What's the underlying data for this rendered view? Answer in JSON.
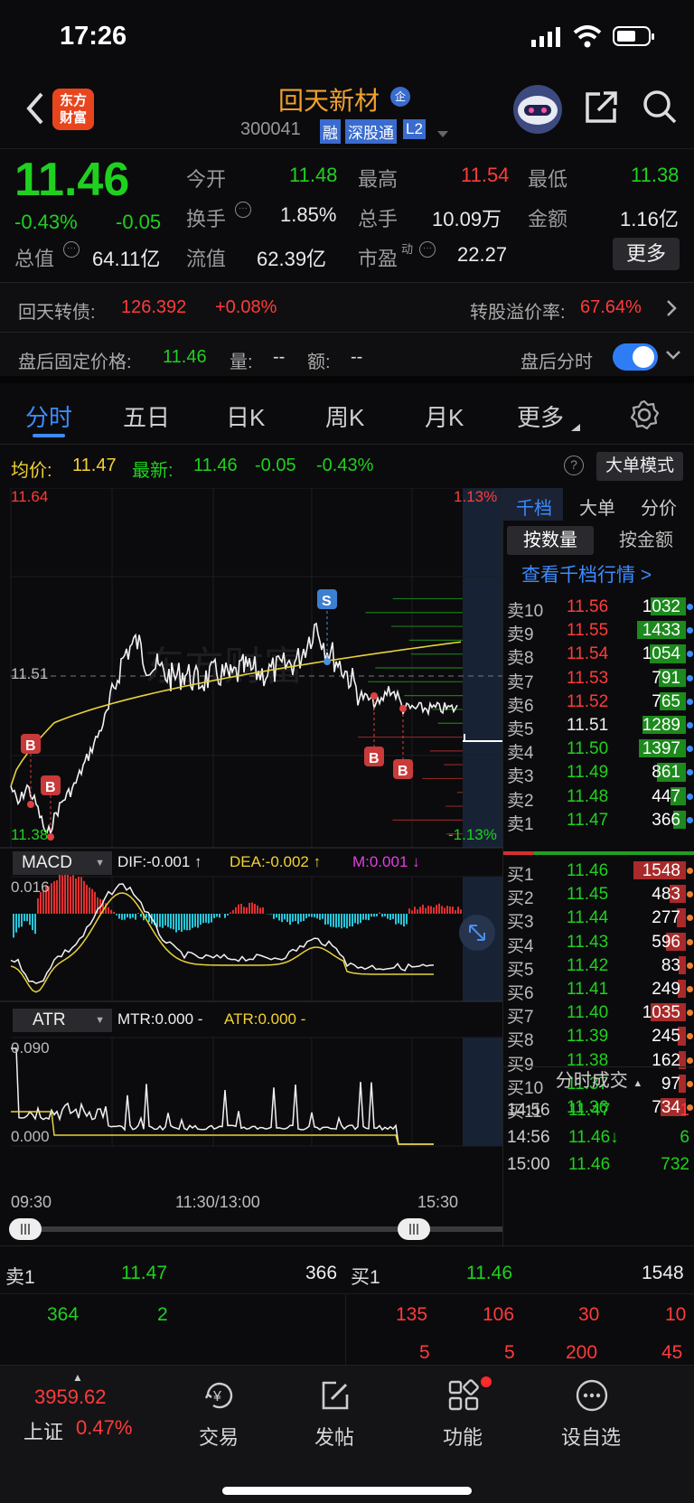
{
  "status": {
    "time": "17:26"
  },
  "header": {
    "logo_line1": "东方",
    "logo_line2": "财富",
    "stock_name": "回天新材",
    "code": "300041",
    "tag_rong": "融",
    "tag_sgt": "深股通",
    "tag_l2": "L2",
    "badge": "企"
  },
  "quote": {
    "price": "11.46",
    "pct": "-0.43%",
    "chg": "-0.05",
    "open_label": "今开",
    "open": "11.48",
    "high_label": "最高",
    "high": "11.54",
    "low_label": "最低",
    "low": "11.38",
    "turnover_label": "换手",
    "turnover": "1.85%",
    "vol_label": "总手",
    "vol": "10.09万",
    "amt_label": "金额",
    "amt": "1.16亿",
    "mcap_label": "总值",
    "mcap": "64.11亿",
    "float_label": "流值",
    "float": "62.39亿",
    "pe_label": "市盈",
    "pe_sup": "动",
    "pe": "22.27",
    "more": "更多"
  },
  "bond": {
    "name": "回天转债:",
    "price": "126.392",
    "pct": "+0.08%",
    "premium_label": "转股溢价率:",
    "premium": "67.64%"
  },
  "after": {
    "label": "盘后固定价格:",
    "price": "11.46",
    "vol_label": "量:",
    "vol": "--",
    "amt_label": "额:",
    "amt": "--",
    "toggle_label": "盘后分时"
  },
  "tabs": [
    "分时",
    "五日",
    "日K",
    "周K",
    "月K",
    "更多"
  ],
  "infobar": {
    "avg_label": "均价:",
    "avg": "11.47",
    "last_label": "最新:",
    "last": "11.46",
    "chg": "-0.05",
    "pct": "-0.43%",
    "mode": "大单模式"
  },
  "chart": {
    "ymax": "11.64",
    "ymid": "11.51",
    "ymin": "11.38",
    "pmax": "1.13%",
    "pmin": "-1.13%",
    "watermark": "东方财富",
    "macd_label": "MACD",
    "dif": "DIF:-0.001 ↑",
    "dea": "DEA:-0.002 ↑",
    "m": "M:0.001 ↓",
    "macd_top": "0.016",
    "atr_label": "ATR",
    "mtr": "MTR:0.000 -",
    "atr": "ATR:0.000 -",
    "atr_top": "0.090",
    "atr_bot": "0.000",
    "t1": "09:30",
    "t2": "11:30/13:00",
    "t3": "15:30",
    "sig_s": "S",
    "sig_b": "B"
  },
  "book": {
    "tab1": "千档",
    "tab2": "大单",
    "tab3": "分价",
    "btn1": "按数量",
    "btn2": "按金额",
    "link": "查看千档行情 >",
    "asks": [
      {
        "l": "卖10",
        "p": "11.56",
        "v": "1032"
      },
      {
        "l": "卖9",
        "p": "11.55",
        "v": "1433"
      },
      {
        "l": "卖8",
        "p": "11.54",
        "v": "1054"
      },
      {
        "l": "卖7",
        "p": "11.53",
        "v": "791"
      },
      {
        "l": "卖6",
        "p": "11.52",
        "v": "765"
      },
      {
        "l": "卖5",
        "p": "11.51",
        "v": "1289"
      },
      {
        "l": "卖4",
        "p": "11.50",
        "v": "1397"
      },
      {
        "l": "卖3",
        "p": "11.49",
        "v": "861"
      },
      {
        "l": "卖2",
        "p": "11.48",
        "v": "447"
      },
      {
        "l": "卖1",
        "p": "11.47",
        "v": "366"
      }
    ],
    "bids": [
      {
        "l": "买1",
        "p": "11.46",
        "v": "1548"
      },
      {
        "l": "买2",
        "p": "11.45",
        "v": "483"
      },
      {
        "l": "买3",
        "p": "11.44",
        "v": "277"
      },
      {
        "l": "买4",
        "p": "11.43",
        "v": "596"
      },
      {
        "l": "买5",
        "p": "11.42",
        "v": "83"
      },
      {
        "l": "买6",
        "p": "11.41",
        "v": "249"
      },
      {
        "l": "买7",
        "p": "11.40",
        "v": "1035"
      },
      {
        "l": "买8",
        "p": "11.39",
        "v": "245"
      },
      {
        "l": "买9",
        "p": "11.38",
        "v": "162"
      },
      {
        "l": "买10",
        "p": "11.37",
        "v": "97"
      },
      {
        "l": "买11",
        "p": "11.36",
        "v": "734"
      }
    ],
    "trades_title": "分时成交",
    "trades": [
      {
        "t": "14:56",
        "p": "11.47",
        "v": "1"
      },
      {
        "t": "14:56",
        "p": "11.46↓",
        "v": "6"
      },
      {
        "t": "15:00",
        "p": "11.46",
        "v": "732"
      }
    ]
  },
  "bottom": {
    "s_label": "卖1",
    "s_price": "11.47",
    "s_vol": "366",
    "b_label": "买1",
    "b_price": "11.46",
    "b_vol": "1548",
    "s_q": [
      "364",
      "2"
    ],
    "b_q1": [
      "135",
      "106",
      "30",
      "10"
    ],
    "b_q2": [
      "5",
      "5",
      "200",
      "45"
    ]
  },
  "nav": {
    "index_val": "3959.62",
    "index_name": "上证",
    "index_pct": "0.47%",
    "trade": "交易",
    "post": "发帖",
    "func": "功能",
    "watch": "设自选"
  }
}
